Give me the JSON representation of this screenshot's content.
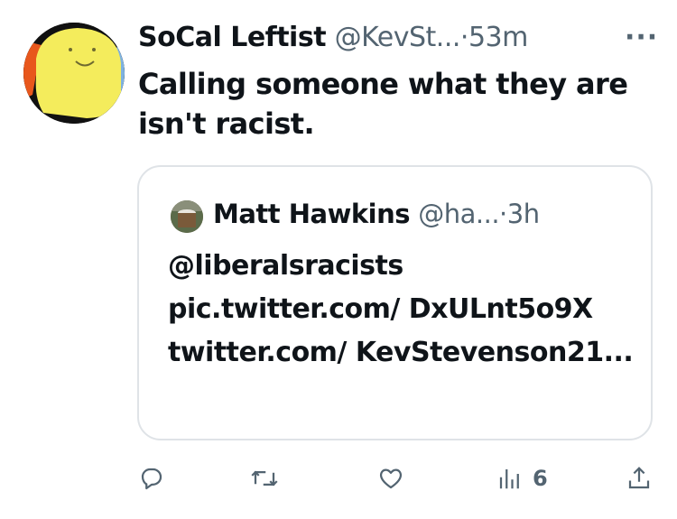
{
  "tweet": {
    "author_name": "SoCal Leftist",
    "handle": "@KevSt...",
    "separator": "·",
    "time": "53m",
    "more": "···",
    "text": "Calling someone what they are isn't racist."
  },
  "quoted_tweet": {
    "author_name": "Matt Hawkins",
    "handle": "@ha...",
    "separator": "·",
    "time": "3h",
    "text": "@liberalsracists pic.twitter.com/ DxULnt5o9X twitter.com/ KevStevenson21..."
  },
  "actions": {
    "reply": {
      "icon": "reply-icon",
      "count": ""
    },
    "retweet": {
      "icon": "retweet-icon",
      "count": ""
    },
    "like": {
      "icon": "heart-icon",
      "count": ""
    },
    "views": {
      "icon": "views-icon",
      "count": "6"
    },
    "share": {
      "icon": "share-icon"
    }
  },
  "colors": {
    "text_primary": "#0f1419",
    "text_secondary": "#536471",
    "border": "#dfe3e7",
    "avatar_face": "#f4ec5c",
    "avatar_accent_left": "#e8571c",
    "avatar_accent_right": "#7fb2e0"
  }
}
